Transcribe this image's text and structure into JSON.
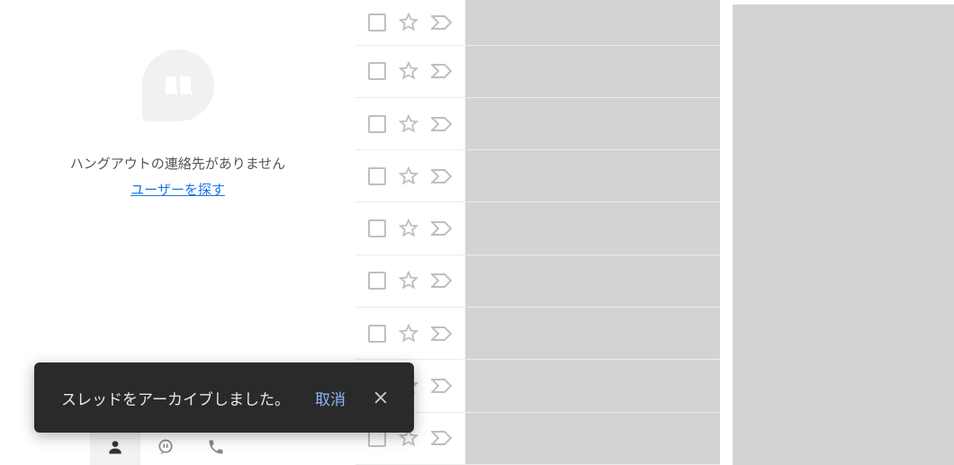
{
  "sidebar": {
    "empty_message": "ハングアウトの連絡先がありません",
    "find_user_link": "ユーザーを探す",
    "tabs": [
      {
        "name": "contacts",
        "active": true
      },
      {
        "name": "hangouts",
        "active": false
      },
      {
        "name": "calls",
        "active": false
      }
    ]
  },
  "mail_list": {
    "row_count": 9
  },
  "toast": {
    "message": "スレッドをアーカイブしました。",
    "undo_label": "取消"
  },
  "colors": {
    "toast_bg": "#2a2a2a",
    "toast_text": "#e8e8e8",
    "link": "#1a73e8",
    "icon_muted": "#bfbfbf",
    "placeholder": "#d3d3d3"
  }
}
